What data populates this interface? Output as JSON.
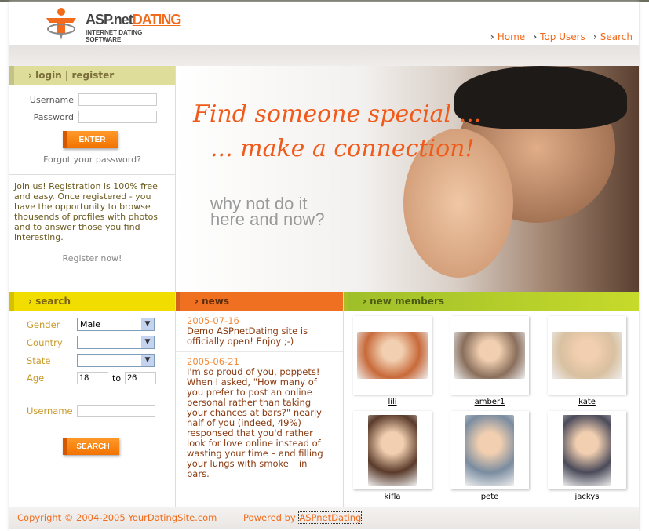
{
  "logo": {
    "brand_main": "ASP.net",
    "brand_accent": "DATING",
    "tagline": "INTERNET DATING SOFTWARE"
  },
  "nav": [
    {
      "label": "Home"
    },
    {
      "label": "Top Users"
    },
    {
      "label": "Search"
    }
  ],
  "login": {
    "heading": "login | register",
    "username_label": "Username",
    "password_label": "Password",
    "enter_label": "ENTER",
    "forgot": "Forgot your password?",
    "join_text": "Join us! Registration is 100% free and easy. Once registered - you have the opportunity to browse thousends of profiles with photos and to answer those you find interesting.",
    "register": "Register now!"
  },
  "hero": {
    "line1": "Find someone special ...",
    "line2": "... make a connection!",
    "line3": "why not do it here and now?"
  },
  "search": {
    "heading": "search",
    "gender_label": "Gender",
    "gender_value": "Male",
    "country_label": "Country",
    "state_label": "State",
    "age_label": "Age",
    "age_from": "18",
    "age_to_label": "to",
    "age_to": "26",
    "username_label": "Username",
    "button": "SEARCH"
  },
  "news": {
    "heading": "news",
    "items": [
      {
        "date": "2005-07-16",
        "text": "Demo ASPnetDating site is officially open! Enjoy ;-)"
      },
      {
        "date": "2005-06-21",
        "text": "I'm so proud of you, poppets! When I asked, \"How many of you prefer to post an online personal rather than taking your chances at bars?\" nearly half of you (indeed, 49%) responsed that you'd rather look for love online instead of wasting your time – and filling your lungs with smoke – in bars."
      }
    ]
  },
  "members": {
    "heading": "new members",
    "items": [
      {
        "name": "lili",
        "color": "#c86a3a"
      },
      {
        "name": "amber1",
        "color": "#8a6f5c"
      },
      {
        "name": "kate",
        "color": "#d8c0a0"
      },
      {
        "name": "kifla",
        "color": "#5a3a2a"
      },
      {
        "name": "pete",
        "color": "#7a8ca0"
      },
      {
        "name": "jackys",
        "color": "#4a4a5a"
      }
    ]
  },
  "footer": {
    "copyright": "Copyright © 2004-2005 YourDatingSite.com",
    "powered": "Powered by",
    "powered_link": "ASPnetDating"
  }
}
